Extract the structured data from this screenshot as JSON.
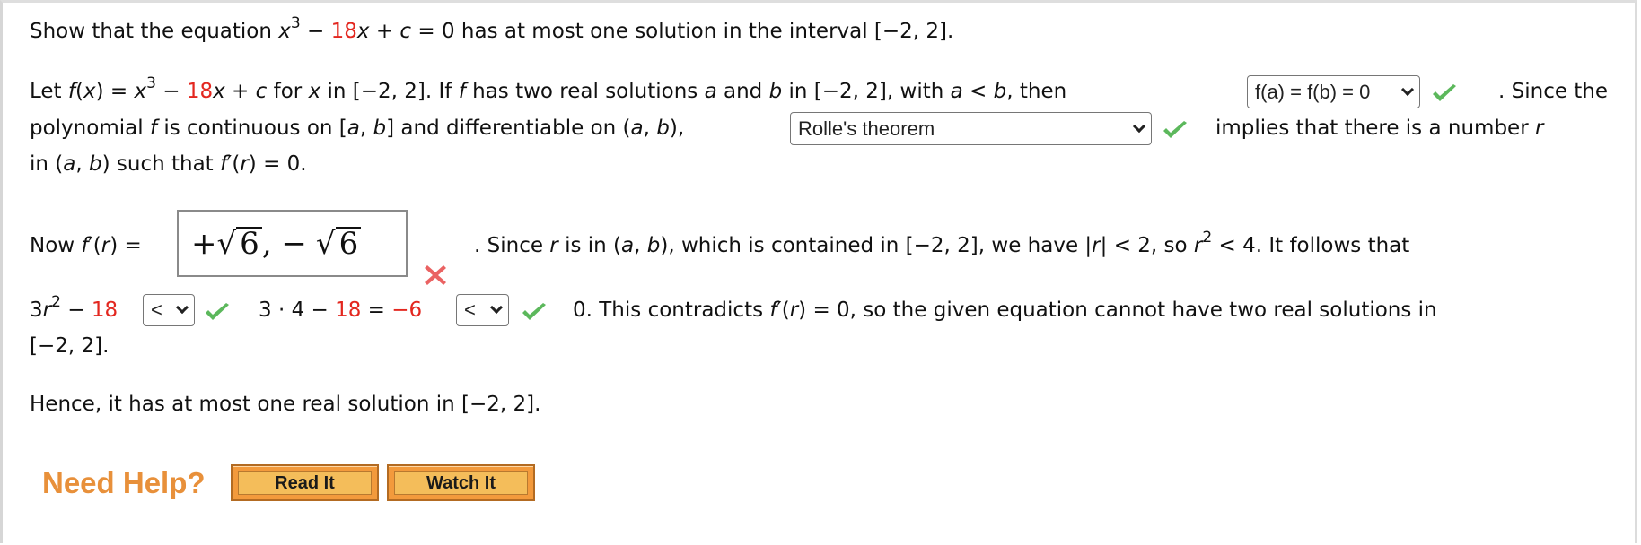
{
  "colors": {
    "highlight_red": "#e3271f",
    "correct_green": "#5cb85c",
    "wrong_red": "#e64646",
    "help_orange": "#e8903a",
    "help_button_fill": "#f4bd5a"
  },
  "problem": {
    "line1": {
      "pre": "Show that the equation ",
      "x": "x",
      "exp": "3",
      "minus": " − ",
      "coef": "18",
      "rest_var": "x",
      "rest": " + ",
      "c": "c",
      "tail": " = 0 has at most one solution in the interval [−2, 2]."
    },
    "line2": {
      "let": "Let ",
      "f": "f",
      "paren_open": "(",
      "x1": "x",
      "eq": ") = ",
      "x2": "x",
      "exp": "3",
      "minus": " − ",
      "coef": "18",
      "x3": "x",
      "plus": " + ",
      "c": "c",
      "for": " for ",
      "x4": "x",
      "in": " in [−2, 2]. If ",
      "f2": "f",
      "has": " has two real solutions ",
      "a": "a",
      "and": " and ",
      "b": "b",
      "in2": " in [−2, 2], with ",
      "a2": "a",
      "lt": " < ",
      "b2": "b",
      "then": ", then",
      "after": ". Since the"
    },
    "select1": {
      "value": "f(a) = f(b) = 0",
      "status": "correct"
    },
    "line3": {
      "pre": "polynomial ",
      "f": "f",
      "mid": " is continuous on [",
      "a": "a",
      "comma": ", ",
      "b": "b",
      "mid2": "] and differentiable on (",
      "a2": "a",
      "comma2": ", ",
      "b2": "b",
      "end": "),",
      "after": "implies that there is a number ",
      "r": "r"
    },
    "select2": {
      "value": "Rolle's theorem",
      "status": "correct"
    },
    "line4": {
      "pre": "in (",
      "a": "a",
      "comma": ", ",
      "b": "b",
      "mid": ") such that ",
      "f": "f",
      "prime": "′(",
      "r": "r",
      "end": ") = 0."
    },
    "line5": {
      "now": "Now ",
      "f": "f",
      "prime": "′(",
      "r": "r",
      "eq": ") =",
      "since": ". Since ",
      "r2": "r",
      "is_in": " is in (",
      "a": "a",
      "comma": ", ",
      "b": "b",
      "contained": "), which is contained in [−2, 2], we have |",
      "r3": "r",
      "abs_end": "| < 2, so ",
      "r4": "r",
      "exp": "2",
      "follows": " < 4. It follows that"
    },
    "answer_box": {
      "plus": "+",
      "rad1": "6",
      "sep": ", −",
      "rad2": "6",
      "status": "incorrect"
    },
    "line6": {
      "three": "3",
      "r": "r",
      "exp": "2",
      "minus": " − ",
      "coef": "18",
      "mid": "3 · 4 − ",
      "coef2": "18",
      "eq": " = ",
      "neg6": "−6",
      "tail": "0. This contradicts ",
      "f": "f",
      "prime": "′(",
      "r2": "r",
      "tail2": ") = 0, so the given equation cannot have two real solutions in"
    },
    "select3": {
      "value": "<",
      "status": "correct"
    },
    "select4": {
      "value": "<",
      "status": "correct"
    },
    "line7": "[−2, 2].",
    "line8": "Hence, it has at most one real solution in [−2, 2]."
  },
  "help": {
    "label": "Need Help?",
    "read_it": "Read It",
    "watch_it": "Watch It"
  }
}
